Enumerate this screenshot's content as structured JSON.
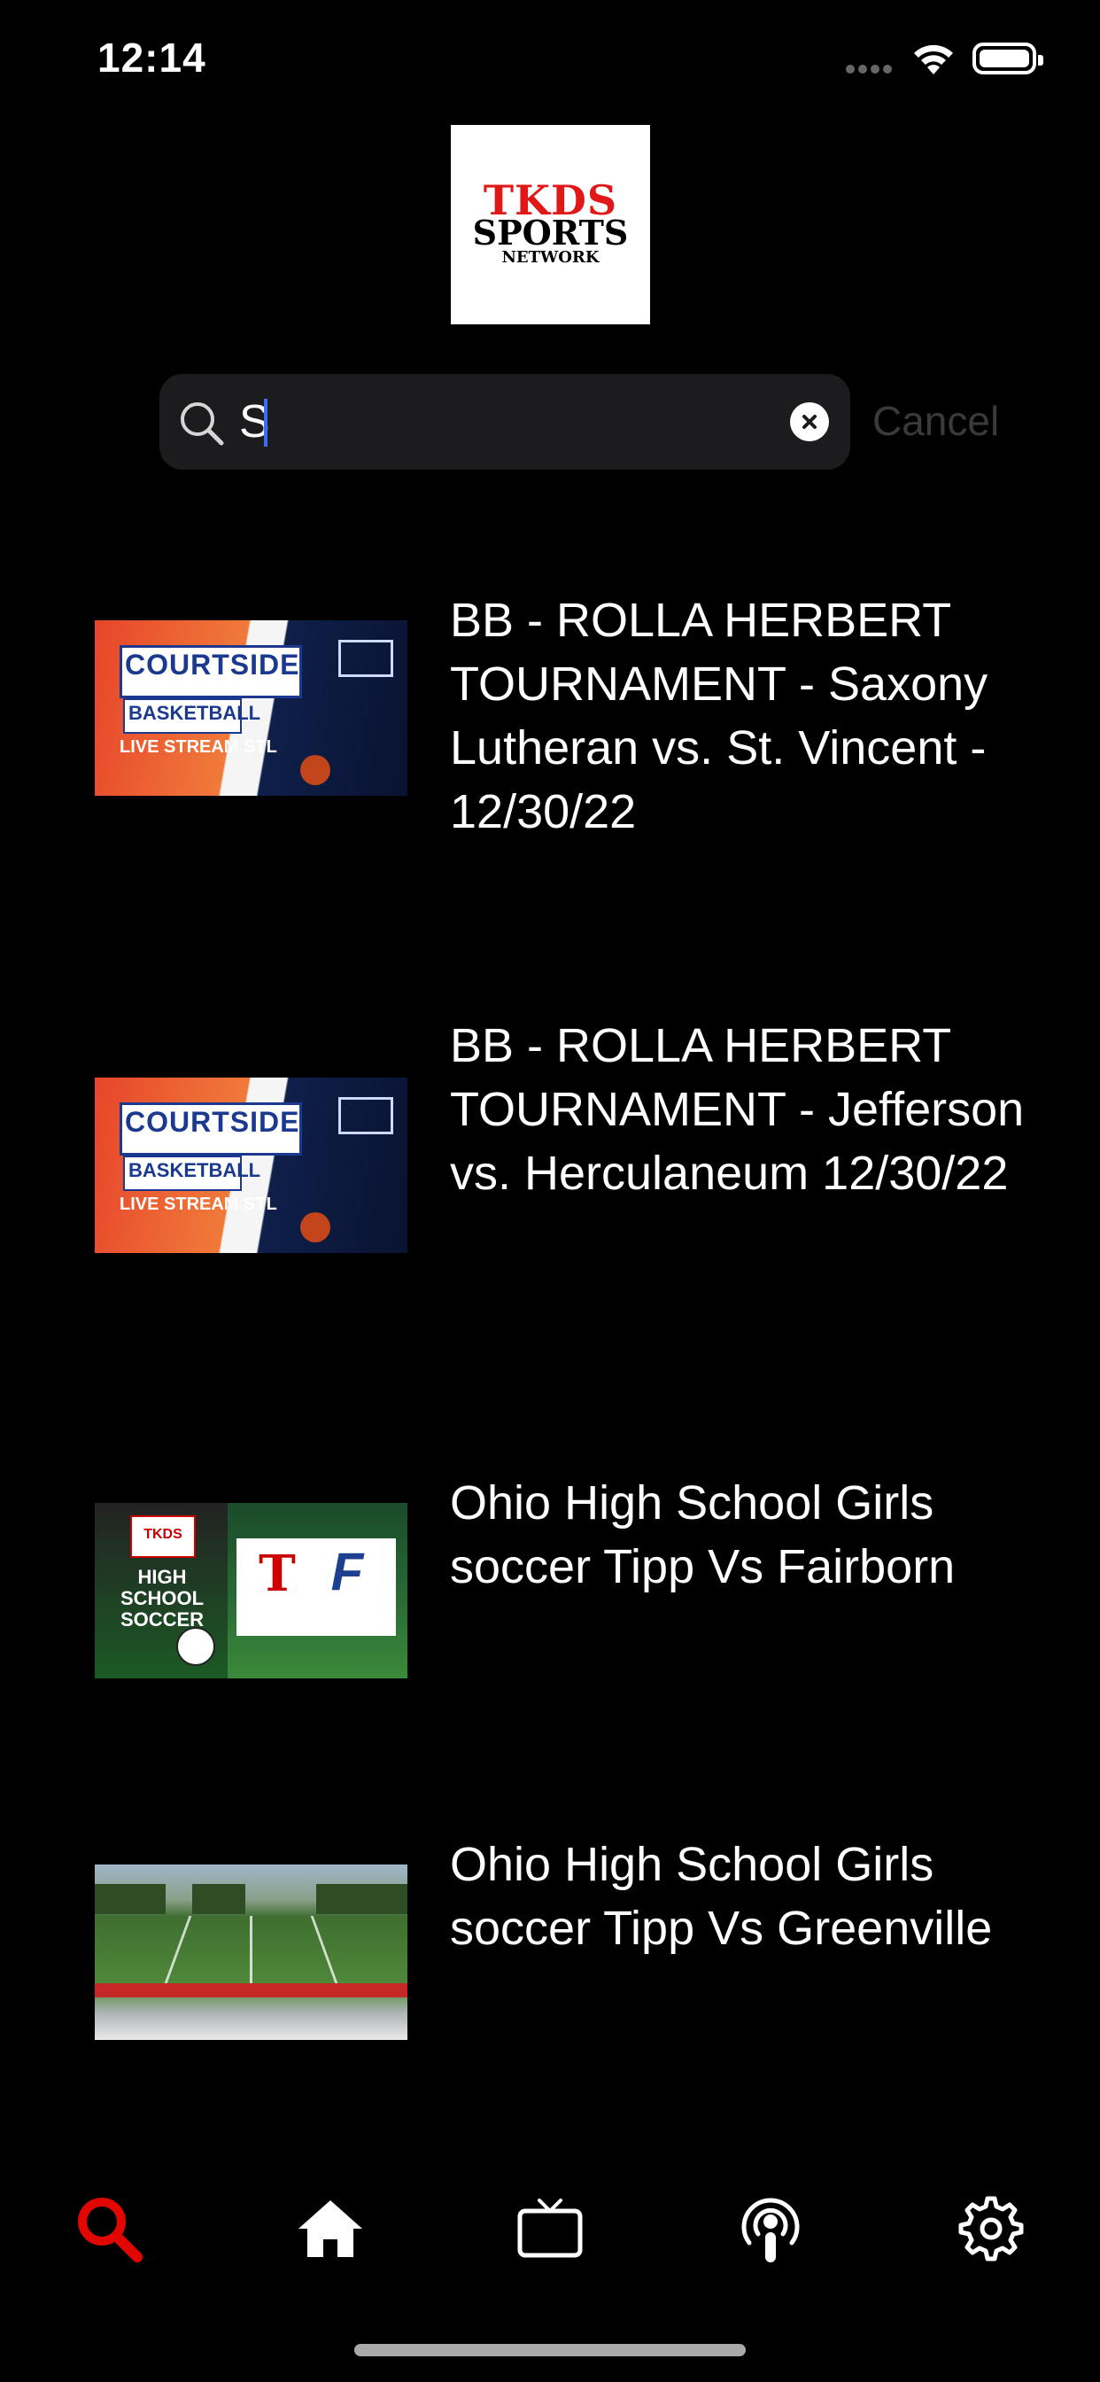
{
  "status_bar": {
    "time": "12:14"
  },
  "logo": {
    "line1": "TKDS",
    "line2": "SPORTS",
    "line3": "NETWORK"
  },
  "search": {
    "value": "S",
    "cancel_label": "Cancel"
  },
  "results": [
    {
      "title": "BB - ROLLA HERBERT TOURNAMENT - Saxony Lutheran vs. St. Vincent - 12/30/22",
      "thumb": {
        "court": "COURTSIDE",
        "basketball": "BASKETBALL",
        "live": "LIVE STREAM STL"
      }
    },
    {
      "title": "BB - ROLLA HERBERT TOURNAMENT - Jefferson vs. Herculaneum 12/30/22",
      "thumb": {
        "court": "COURTSIDE",
        "basketball": "BASKETBALL",
        "live": "LIVE STREAM STL"
      }
    },
    {
      "title": "Ohio High School Girls soccer Tipp Vs Fairborn",
      "thumb": {
        "badge": "TKDS",
        "caption": "HIGH SCHOOL SOCCER",
        "team1": "T",
        "team2": "F"
      }
    },
    {
      "title": "Ohio High School Girls soccer Tipp Vs Greenville"
    }
  ],
  "tabbar": {
    "active_color": "#e10600",
    "tabs": [
      {
        "icon": "search-icon",
        "active": true
      },
      {
        "icon": "home-icon",
        "active": false
      },
      {
        "icon": "tv-icon",
        "active": false
      },
      {
        "icon": "podcast-icon",
        "active": false
      },
      {
        "icon": "gear-icon",
        "active": false
      }
    ]
  }
}
